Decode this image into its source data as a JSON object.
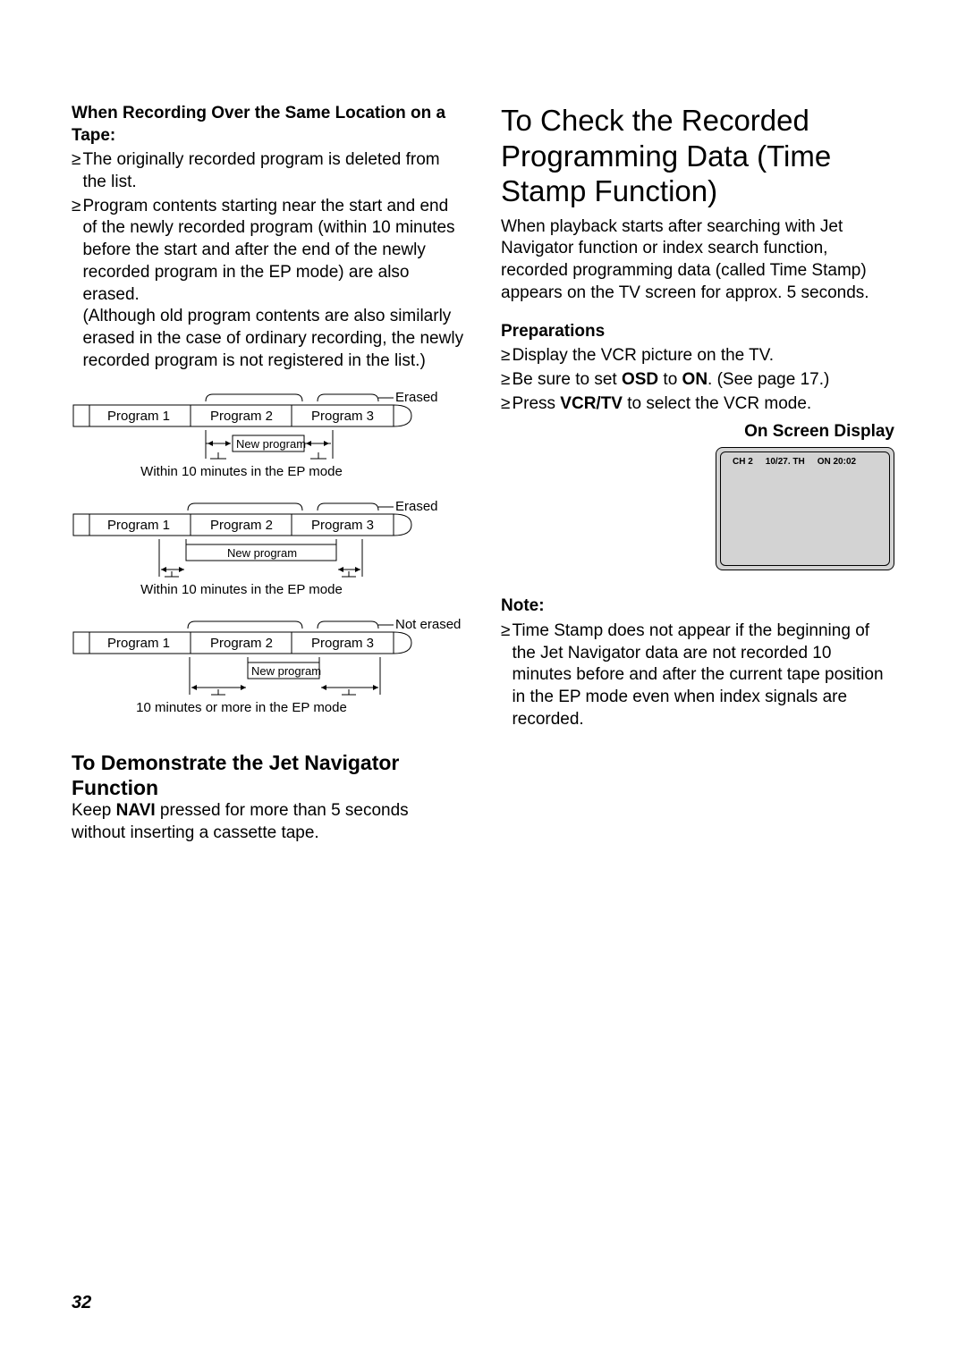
{
  "left": {
    "heading": "When Recording Over the Same Location on a Tape:",
    "bullet1": "The originally recorded program is deleted from the list.",
    "bullet2": "Program contents starting near the start and end of the newly recorded program (within 10 minutes before the start and after the end of the newly recorded program in the EP mode) are also erased.",
    "sub2": "(Although old program contents are also similarly erased in the case of ordinary recording, the newly recorded program is not registered in the list.)",
    "diagram": {
      "prog1": "Program 1",
      "prog2": "Program 2",
      "prog3": "Program 3",
      "newprog": "New program",
      "erased": "Erased",
      "not_erased": "Not erased",
      "caption1": "Within 10 minutes in the EP mode",
      "caption2": "Within 10 minutes in the EP mode",
      "caption3": "10 minutes or more in the EP mode"
    },
    "h2": "To Demonstrate the Jet Navigator Function",
    "body_pre": "Keep ",
    "body_bold": "NAVI",
    "body_post": " pressed for more than 5 seconds without inserting a cassette tape."
  },
  "right": {
    "title": "To Check the Recorded Programming Data (Time Stamp Function)",
    "intro": "When playback starts after searching with Jet Navigator function or index search function, recorded programming data (called Time Stamp) appears on the TV screen for approx. 5 seconds.",
    "prep_heading": "Preparations",
    "prep1": "Display the VCR picture on the TV.",
    "prep2_pre": "Be sure to set ",
    "prep2_b1": "OSD",
    "prep2_mid": " to ",
    "prep2_b2": "ON",
    "prep2_post": ". (See page 17.)",
    "prep3_pre": "Press ",
    "prep3_b": "VCR/TV",
    "prep3_post": " to select the VCR mode.",
    "osd_label": "On Screen Display",
    "osd": {
      "ch": "CH 2",
      "date": "10/27. TH",
      "on": "ON 20:02"
    },
    "note_heading": "Note:",
    "note1": "Time Stamp does not appear if the beginning of the Jet Navigator data are not recorded 10 minutes before and after the current tape position in the EP mode even when index signals are recorded."
  },
  "page_number": "32"
}
